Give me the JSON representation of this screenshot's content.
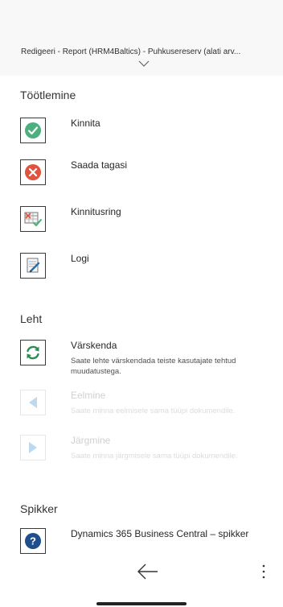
{
  "header": {
    "title": "Redigeeri - Report (HRM4Baltics) - Puhkusereserv (alati arv..."
  },
  "sections": {
    "processing": {
      "title": "Töötlemine",
      "approve": "Kinnita",
      "reject": "Saada tagasi",
      "approval_cycle": "Kinnitusring",
      "log": "Logi"
    },
    "page": {
      "title": "Leht",
      "refresh": "Värskenda",
      "refresh_desc": "Saate lehte värskendada teiste kasutajate tehtud muudatustega.",
      "previous": "Eelmine",
      "previous_desc": "Saate minna eelmisele sama tüüpi dokumendile.",
      "next": "Järgmine",
      "next_desc": "Saate minna järgmisele sama tüüpi dokumendile."
    },
    "help": {
      "title": "Spikker",
      "help_item": "Dynamics 365 Business Central – spikker"
    }
  },
  "colors": {
    "approve_green": "#4caf7d",
    "reject_red": "#e0533e",
    "refresh_green": "#2e8b57",
    "help_blue": "#1f4e8c",
    "disabled_blue": "#bcd9ef"
  }
}
